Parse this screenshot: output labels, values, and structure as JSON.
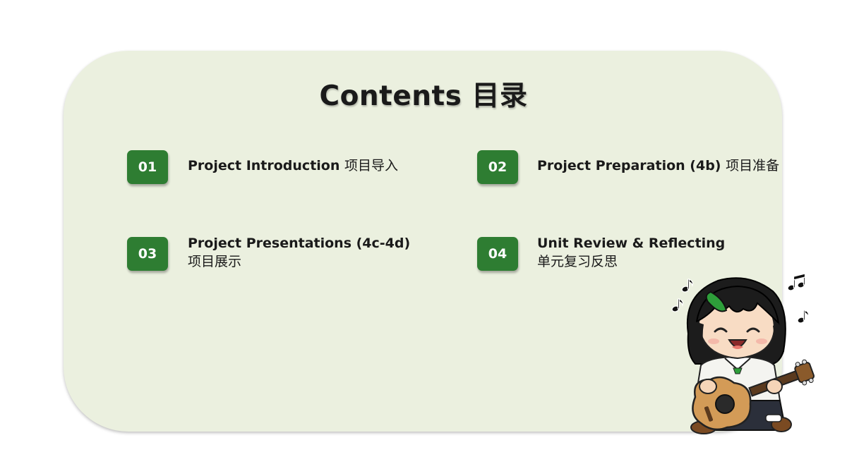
{
  "slide": {
    "title": "Contents  目录",
    "items": [
      {
        "number": "01",
        "label_en": "Project Introduction",
        "label_zh": "项目导入"
      },
      {
        "number": "02",
        "label_en": "Project Preparation (4b)",
        "label_zh": "项目准备"
      },
      {
        "number": "03",
        "label_en": "Project Presentations (4c-4d)",
        "label_zh": "项目展示"
      },
      {
        "number": "04",
        "label_en": "Unit Review & Reflecting",
        "label_zh": "单元复习反思"
      }
    ]
  },
  "colors": {
    "panel": "#ebf0df",
    "badge": "#2e7d32",
    "text": "#1a1a1a"
  },
  "illustration": {
    "subject": "cartoon girl playing guitar with music notes"
  }
}
